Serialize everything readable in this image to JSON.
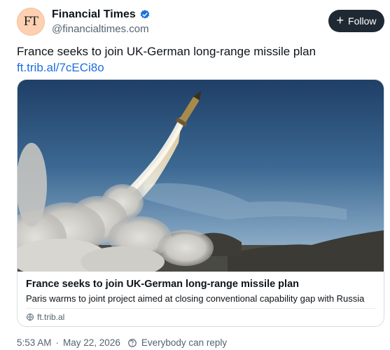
{
  "author": {
    "avatar_text": "FT",
    "display_name": "Financial Times",
    "handle": "@financialtimes.com",
    "verified_icon": "verified-badge-icon"
  },
  "follow_button": {
    "label": "Follow",
    "icon": "plus-icon"
  },
  "post": {
    "text": "France seeks to join UK-German long-range missile plan",
    "link": "ft.trib.al/7cECi8o"
  },
  "card": {
    "image": "missile-launch-photo",
    "title": "France seeks to join UK-German long-range missile plan",
    "description": "Paris warms to joint project aimed at closing conventional capability gap with Russia",
    "domain": "ft.trib.al",
    "domain_icon": "link-icon"
  },
  "footer": {
    "time": "5:53 AM",
    "separator": "·",
    "date": "May 22, 2026",
    "reply_icon": "globe-icon",
    "reply_setting": "Everybody can reply"
  },
  "colors": {
    "accent": "#1d6fe0",
    "avatar_bg": "#fcd0b1",
    "button_bg": "#1f2933",
    "muted_text": "#536471"
  }
}
